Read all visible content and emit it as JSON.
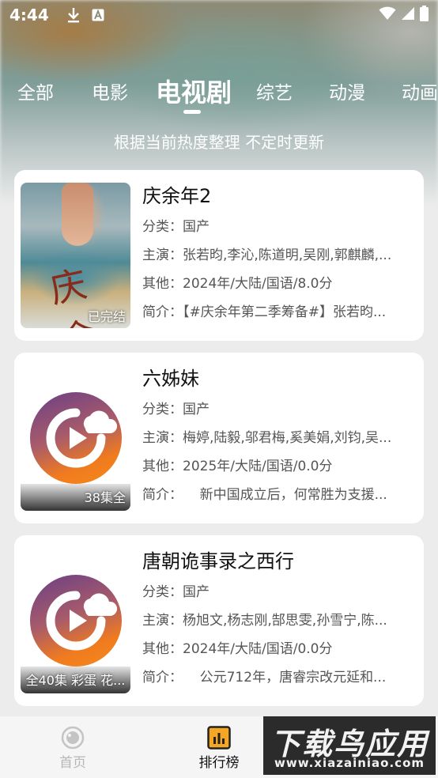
{
  "status_bar": {
    "time": "4:44",
    "icons": [
      "download-icon",
      "font-icon",
      "wifi-icon",
      "signal-icon",
      "battery-icon"
    ]
  },
  "tabs": [
    {
      "label": "全部",
      "active": false
    },
    {
      "label": "电影",
      "active": false
    },
    {
      "label": "电视剧",
      "active": true
    },
    {
      "label": "综艺",
      "active": false
    },
    {
      "label": "动漫",
      "active": false
    },
    {
      "label": "动画",
      "active": false
    }
  ],
  "subtitle": "根据当前热度整理 不定时更新",
  "labels": {
    "category": "分类：",
    "cast": "主演：",
    "other": "其他：",
    "intro": "简介："
  },
  "items": [
    {
      "title": "庆余年2",
      "badge": "已完结",
      "category": "国产",
      "cast": "张若昀,李沁,陈道明,吴刚,郭麒麟,...",
      "other": "2024年/大陆/国语/8.0分",
      "intro": "【#庆余年第二季筹备#】张若昀...",
      "poster": "photo",
      "poster_text": "庆余年"
    },
    {
      "title": "六姊妹",
      "badge": "38集全",
      "category": "国产",
      "cast": "梅婷,陆毅,邬君梅,奚美娟,刘钧,吴...",
      "other": "2025年/大陆/国语/0.0分",
      "intro": "    新中国成立后，何常胜为支援...",
      "poster": "logo"
    },
    {
      "title": "唐朝诡事录之西行",
      "badge": "全40集 彩蛋 花...",
      "category": "国产",
      "cast": "杨旭文,杨志刚,郜思雯,孙雪宁,陈...",
      "other": "2024年/大陆/国语/0.0分",
      "intro": "    公元712年，唐睿宗改元延和...",
      "poster": "logo"
    }
  ],
  "bottom_nav": [
    {
      "label": "首页",
      "icon": "home-icon",
      "active": false
    },
    {
      "label": "排行榜",
      "icon": "ranking-icon",
      "active": true
    }
  ],
  "watermark": {
    "top": "下载鸟应用",
    "bottom": "www.xiazainiao.com"
  },
  "colors": {
    "active_text": "#111111",
    "inactive_text": "#b7b7b7",
    "logo_orange": "#f58a1a",
    "logo_purple": "#6a3f86"
  }
}
